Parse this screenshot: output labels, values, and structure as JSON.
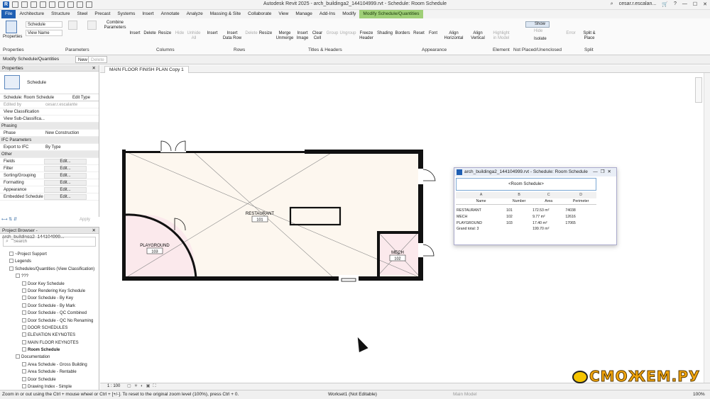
{
  "titlebar": {
    "title": "Autodesk Revit 2025 - arch_buildinga2_144104999.rvt - Schedule: Room Schedule",
    "user": "cesar.r.escalan...",
    "logo": "R"
  },
  "tabs": [
    "File",
    "Architecture",
    "Structure",
    "Steel",
    "Precast",
    "Systems",
    "Insert",
    "Annotate",
    "Analyze",
    "Massing & Site",
    "Collaborate",
    "View",
    "Manage",
    "Add-Ins",
    "Modify",
    "Modify Schedule/Quantities"
  ],
  "ribbon": {
    "properties_label": "Properties",
    "param_select": "Schedule",
    "view_name_select": "View Name",
    "buttons": {
      "combine": "Combine\nParameters",
      "insert": "Insert",
      "delete": "Delete",
      "resize": "Resize",
      "hide": "Hide",
      "unhide_all": "Unhide All",
      "insert2": "Insert",
      "insert_data_row": "Insert\nData Row",
      "delete2": "Delete",
      "resize2": "Resize",
      "merge": "Merge\nUnmerge",
      "insert_image": "Insert\nImage",
      "clear_cell": "Clear\nCell",
      "group": "Group",
      "ungroup": "Ungroup",
      "freeze": "Freeze\nHeader",
      "shading": "Shading",
      "borders": "Borders",
      "reset": "Reset",
      "font": "Font",
      "align_h": "Align\nHorizontal",
      "align_v": "Align\nVertical",
      "highlight": "Highlight\nin Model",
      "show": "Show",
      "hide2": "Hide",
      "isolate": "Isolate",
      "error": "Error",
      "split": "Split &\nPlace"
    },
    "groups": {
      "properties": "Properties",
      "parameters": "Parameters",
      "columns": "Columns",
      "rows": "Rows",
      "titles": "Titles & Headers",
      "appearance": "Appearance",
      "element": "Element",
      "not_placed": "Not Placed/Unenclosed",
      "split": "Split"
    }
  },
  "optionsbar": {
    "mode": "Modify Schedule/Quantities",
    "new_btn": "New",
    "delete_btn": "Delete"
  },
  "properties": {
    "header": "Properties",
    "type_name": "Schedule",
    "selector": "Schedule: Room Schedule",
    "edit_type": "Edit Type",
    "rows": [
      {
        "k": "Edited by",
        "v": "cesar.r.escalante"
      },
      {
        "k": "View Classification",
        "v": ""
      },
      {
        "k": "View Sub-Classifica...",
        "v": ""
      }
    ],
    "phasing_cat": "Phasing",
    "phase_row": {
      "k": "Phase",
      "v": "New Construction"
    },
    "ifc_cat": "IFC Parameters",
    "ifc_row": {
      "k": "Export to IFC",
      "v": "By Type"
    },
    "other_cat": "Other",
    "other_rows": [
      "Fields",
      "Filter",
      "Sorting/Grouping",
      "Formatting",
      "Appearance",
      "Embedded Schedule"
    ],
    "edit_label": "Edit...",
    "apply": "Apply"
  },
  "browser": {
    "header": "Project Browser - arch_buildinga2_144104999...",
    "search_placeholder": "Search",
    "items": [
      {
        "label": "~Project Support",
        "indent": 1
      },
      {
        "label": "Legends",
        "indent": 1
      },
      {
        "label": "Schedules/Quantities (View Classification)",
        "indent": 1
      },
      {
        "label": "???",
        "indent": 2
      },
      {
        "label": "Door Key Schedule",
        "indent": 3
      },
      {
        "label": "Door Rendering Key Schedule",
        "indent": 3
      },
      {
        "label": "Door Schedule - By Key",
        "indent": 3
      },
      {
        "label": "Door Schedule - By Mark",
        "indent": 3
      },
      {
        "label": "Door Schedule - QC Combined",
        "indent": 3
      },
      {
        "label": "Door Schedule - QC No Renaming",
        "indent": 3
      },
      {
        "label": "DOOR SCHEDULES",
        "indent": 3
      },
      {
        "label": "ELEVATION KEYNOTES",
        "indent": 3
      },
      {
        "label": "MAIN FLOOR KEYNOTES",
        "indent": 3
      },
      {
        "label": "Room Schedule",
        "indent": 3,
        "bold": true
      },
      {
        "label": "Documentation",
        "indent": 2
      },
      {
        "label": "Area Schedule - Gross Building",
        "indent": 3
      },
      {
        "label": "Area Schedule - Rentable",
        "indent": 3
      },
      {
        "label": "Door Schedule",
        "indent": 3
      },
      {
        "label": "Drawing Index - Simple",
        "indent": 3
      }
    ]
  },
  "view_tab": "MAIN FLOOR FINISH PLAN Copy 1",
  "plan": {
    "rooms": [
      {
        "name": "RESTAURANT",
        "number": "101"
      },
      {
        "name": "PLAYGROUND",
        "number": "103"
      },
      {
        "name": "MECH",
        "number": "102"
      }
    ]
  },
  "schedule_window": {
    "title": "arch_buildinga2_144104999.rvt - Schedule: Room Schedule",
    "schedule_title": "<Room Schedule>",
    "letters": [
      "A",
      "B",
      "C",
      "D"
    ],
    "headers": [
      "Name",
      "Number",
      "Area",
      "Perimeter"
    ],
    "rows": [
      [
        "RESTAURANT",
        "101",
        "172.53 m²",
        "74038"
      ],
      [
        "MECH",
        "102",
        "9.77 m²",
        "12616"
      ],
      [
        "PLAYGROUND",
        "103",
        "17.40 m²",
        "17065"
      ]
    ],
    "grand_total": "Grand total: 3",
    "grand_area": "199.70 m²"
  },
  "viewbar": {
    "scale": "1 : 100"
  },
  "status": {
    "hint": "Zoom in or out using the Ctrl + mouse wheel or Ctrl + [+/-]. To reset to the original zoom level (100%), press Ctrl + 0.",
    "workset": "Workset1 (Not Editable)",
    "model": "Main Model",
    "zoom": "100%"
  },
  "watermark": "СМОЖЕМ.РУ"
}
